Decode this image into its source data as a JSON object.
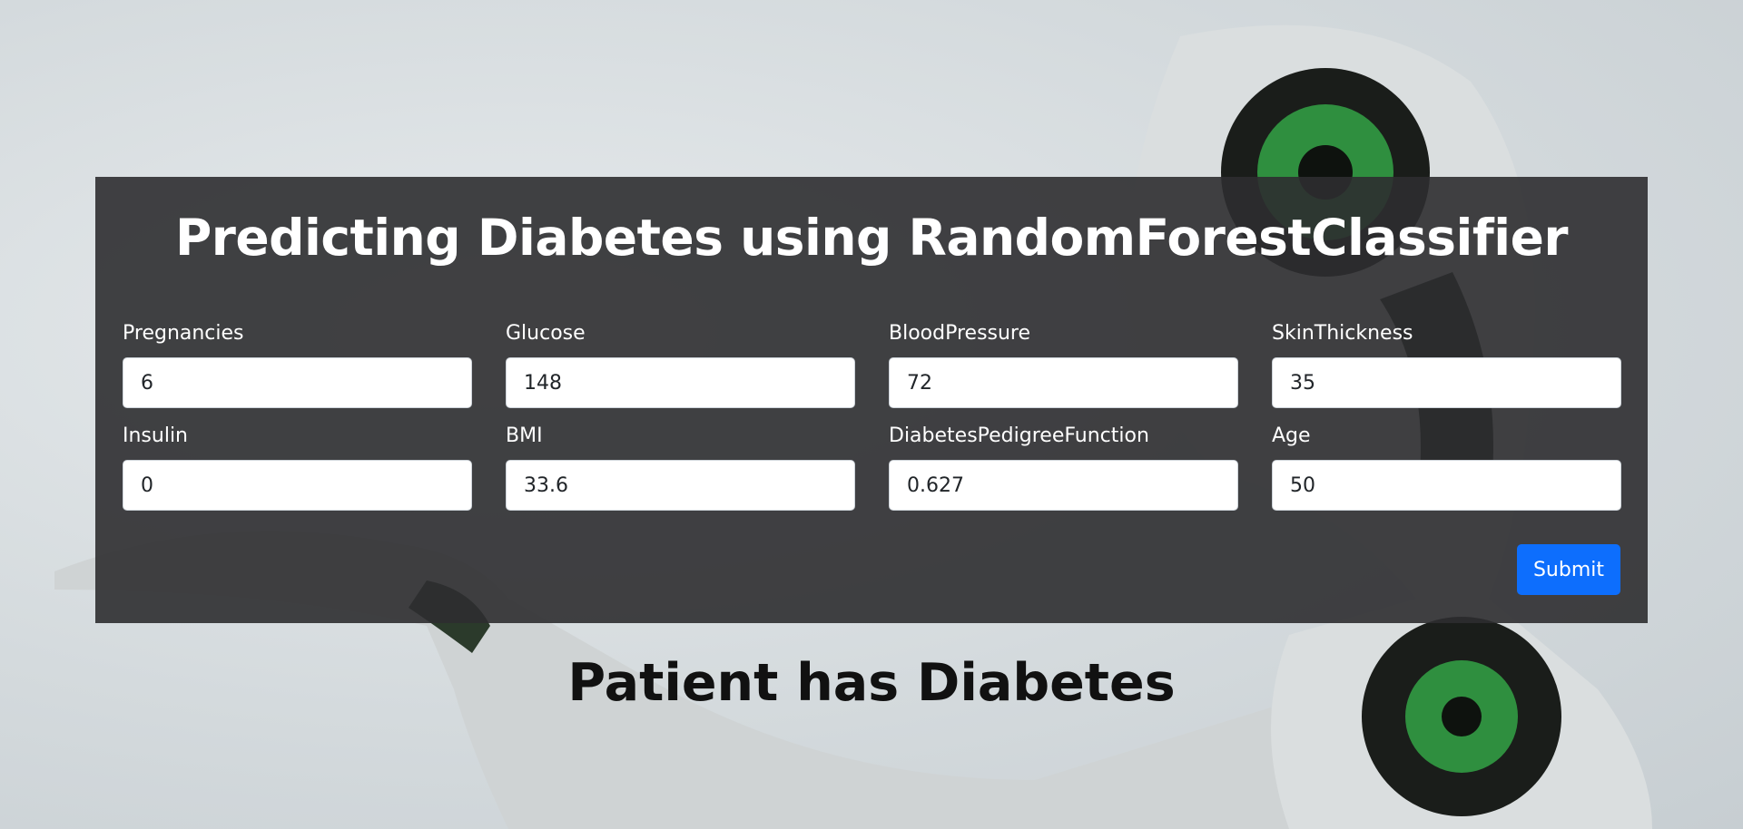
{
  "form": {
    "title": "Predicting Diabetes using RandomForestClassifier",
    "fields": [
      {
        "label": "Pregnancies",
        "value": "6"
      },
      {
        "label": "Glucose",
        "value": "148"
      },
      {
        "label": "BloodPressure",
        "value": "72"
      },
      {
        "label": "SkinThickness",
        "value": "35"
      },
      {
        "label": "Insulin",
        "value": "0"
      },
      {
        "label": "BMI",
        "value": "33.6"
      },
      {
        "label": "DiabetesPedigreeFunction",
        "value": "0.627"
      },
      {
        "label": "Age",
        "value": "50"
      }
    ],
    "submit_label": "Submit"
  },
  "result": {
    "text": "Patient has Diabetes"
  },
  "colors": {
    "panel": "#2d2e30",
    "submit": "#0d6efd",
    "background": "#d4dadd"
  }
}
